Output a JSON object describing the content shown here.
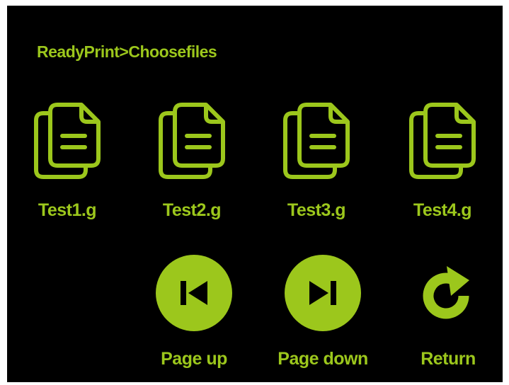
{
  "theme": {
    "accent": "#9cc71c",
    "background": "#000000"
  },
  "header": {
    "breadcrumb": "ReadyPrint>Choosefiles"
  },
  "files": [
    {
      "name": "Test1.g",
      "icon": "file-copy-icon"
    },
    {
      "name": "Test2.g",
      "icon": "file-copy-icon"
    },
    {
      "name": "Test3.g",
      "icon": "file-copy-icon"
    },
    {
      "name": "Test4.g",
      "icon": "file-copy-icon"
    }
  ],
  "controls": {
    "page_up": {
      "label": "Page up",
      "icon": "skip-previous-icon"
    },
    "page_down": {
      "label": "Page down",
      "icon": "skip-next-icon"
    },
    "return": {
      "label": "Return",
      "icon": "return-icon"
    }
  }
}
